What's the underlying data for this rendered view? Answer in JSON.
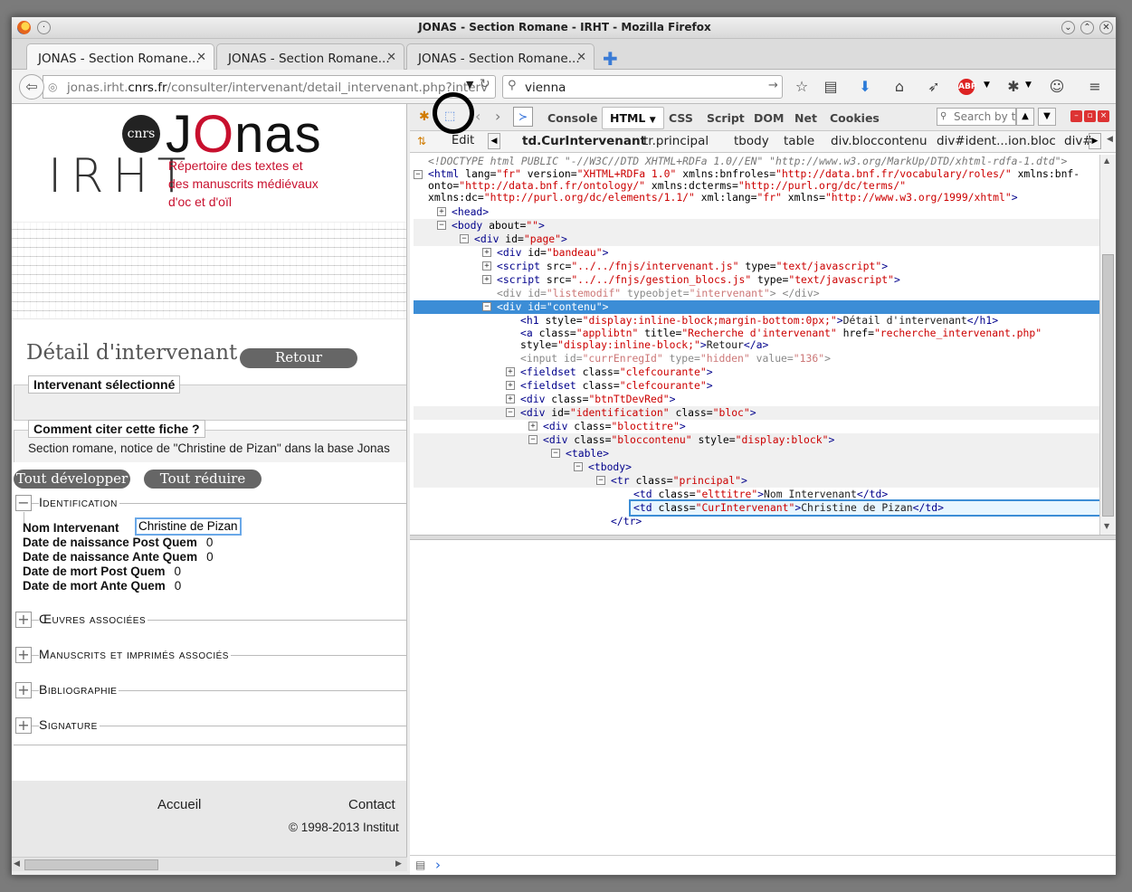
{
  "window": {
    "title": "JONAS - Section Romane - IRHT - Mozilla Firefox"
  },
  "tabs": [
    {
      "label": "JONAS - Section Romane..."
    },
    {
      "label": "JONAS - Section Romane..."
    },
    {
      "label": "JONAS - Section Romane..."
    }
  ],
  "nav": {
    "url_host_pre": "jonas.irht.",
    "url_host_bold": "cnrs.fr",
    "url_path": "/consulter/intervenant/detail_intervenant.php?interv",
    "search_value": "vienna"
  },
  "site": {
    "cnrs": "cnrs",
    "logo_j": "J",
    "logo_o": "O",
    "logo_rest": "nas",
    "irht": "IRHT",
    "tagline": "Répertoire des textes et des manuscrits médiévaux d'oc et d'oïl"
  },
  "page": {
    "title": "Détail d'intervenant",
    "retour": "Retour",
    "legend_selected": "Intervenant sélectionné",
    "legend_cite": "Comment citer cette fiche ?",
    "cite_text": "Section romane, notice de \"Christine de Pizan\" dans la base Jonas",
    "expand_all": "Tout développer",
    "collapse_all": "Tout réduire",
    "sections": [
      {
        "sign": "−",
        "label": "Identification"
      },
      {
        "sign": "+",
        "label": "Œuvres associées"
      },
      {
        "sign": "+",
        "label": "Manuscrits et imprimés associés"
      },
      {
        "sign": "+",
        "label": "Bibliographie"
      },
      {
        "sign": "+",
        "label": "Signature"
      }
    ],
    "fields": [
      {
        "label": "Nom Intervenant",
        "value": "Christine de Pizan"
      },
      {
        "label": "Date de naissance Post Quem",
        "value": "0"
      },
      {
        "label": "Date de naissance Ante Quem",
        "value": "0"
      },
      {
        "label": "Date de mort Post Quem",
        "value": "0"
      },
      {
        "label": "Date de mort Ante Quem",
        "value": "0"
      }
    ],
    "footer": {
      "home": "Accueil",
      "contact": "Contact",
      "copyright": "© 1998-2013 Institut"
    }
  },
  "devtools": {
    "tabs": [
      "Console",
      "HTML",
      "CSS",
      "Script",
      "DOM",
      "Net",
      "Cookies"
    ],
    "search_placeholder": "Search by t",
    "edit": "Edit",
    "breadcrumbs": [
      "td.CurIntervenant",
      "tr.principal",
      "tbody",
      "table",
      "div.bloccontenu",
      "div#ident...ion.bloc",
      "div#"
    ],
    "doctype": "<!DOCTYPE html PUBLIC \"-//W3C//DTD XHTML+RDFa 1.0//EN\" \"http://www.w3.org/MarkUp/DTD/xhtml-rdfa-1.dtd\">",
    "cmd_prompt": "›"
  }
}
